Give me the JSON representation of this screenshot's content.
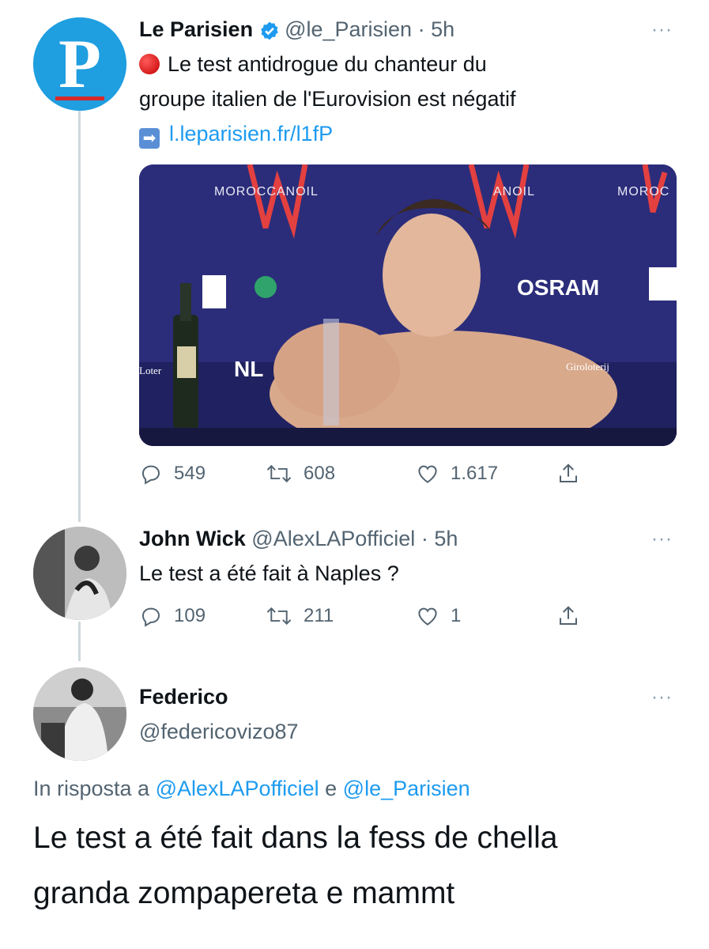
{
  "tweets": [
    {
      "name": "Le Parisien",
      "handle": "@le_Parisien",
      "time": "· 5h",
      "text_line1": "Le test antidrogue du chanteur du",
      "text_line2": "groupe italien de l'Eurovision est négatif",
      "link": "l.leparisien.fr/l1fP",
      "media": {
        "banner_left": "MOROCCANOIL",
        "banner_mid": "ANOIL",
        "banner_right": "MOROC",
        "sponsor_osram": "OSRAM",
        "sponsor_nl": "NL",
        "sponsor_lotto": "Giroloterij",
        "sponsor_loter": "Loter"
      },
      "replies": "549",
      "retweets": "608",
      "likes": "1.617"
    },
    {
      "name": "John Wick",
      "handle": "@AlexLAPofficiel",
      "time": "· 5h",
      "text": "Le test a été fait à Naples ?",
      "replies": "109",
      "retweets": "211",
      "likes": "1"
    },
    {
      "name": "Federico",
      "handle": "@federicovizo87",
      "reply_prefix": "In risposta a",
      "reply_to1": "@AlexLAPofficiel",
      "reply_and": "e",
      "reply_to2": "@le_Parisien",
      "text_line1": "Le test a été fait dans la fess de chella",
      "text_line2": "granda zompapereta e mammt"
    }
  ],
  "more_label": "···",
  "colors": {
    "link": "#1d9bf0",
    "muted": "#536471",
    "verified": "#1d9bf0",
    "parisien_blue": "#1f9ee0",
    "parisien_red": "#d62a2a"
  }
}
